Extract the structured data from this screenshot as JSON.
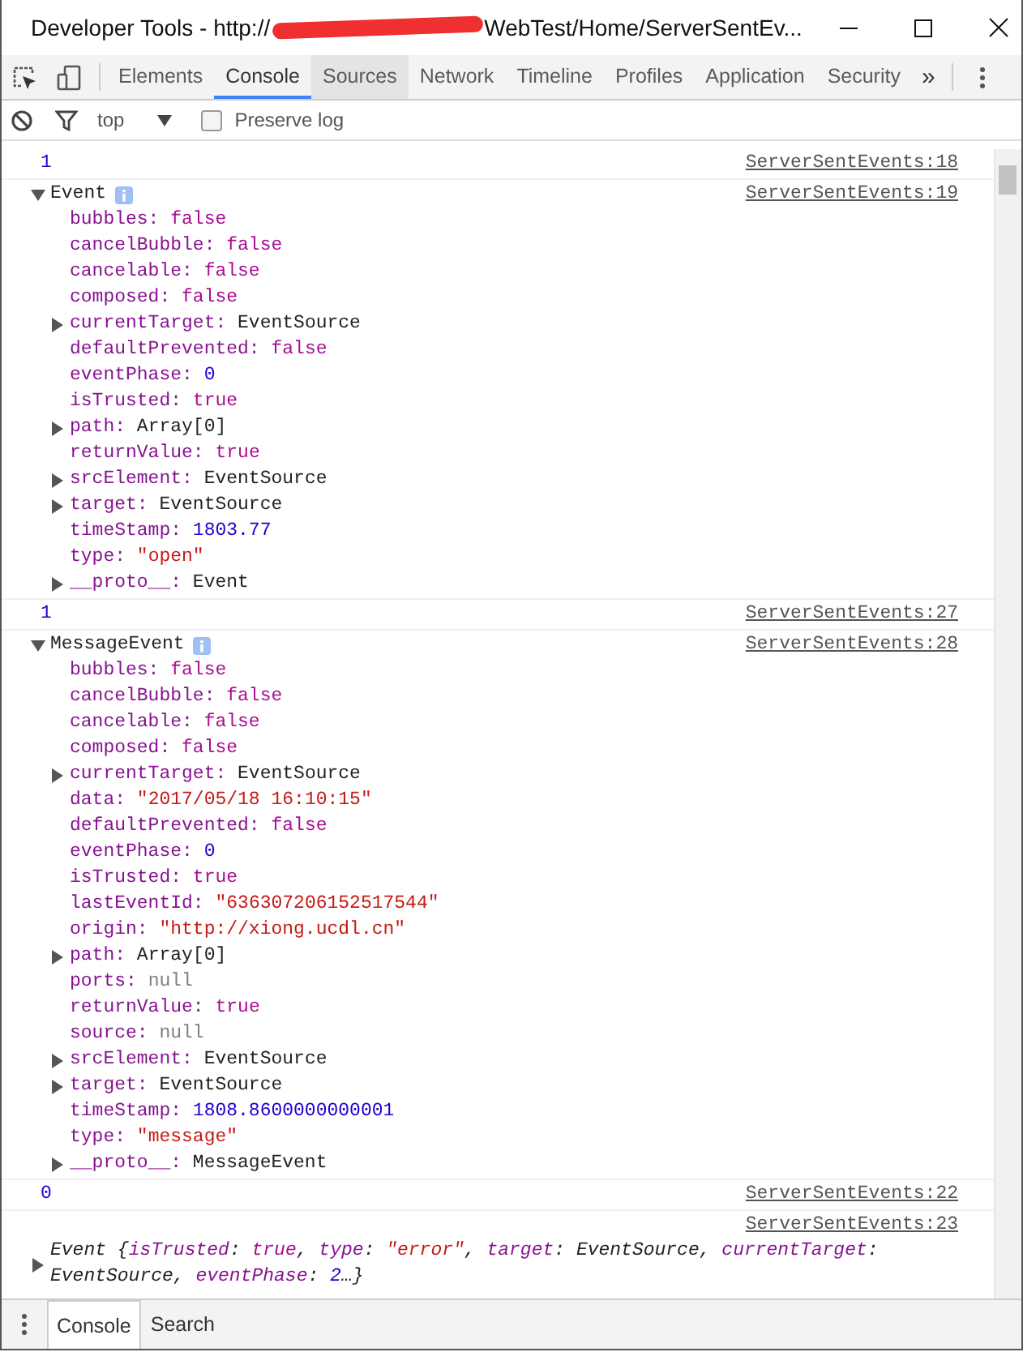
{
  "window": {
    "title_start": "Developer Tools - http://",
    "title_end": "WebTest/Home/ServerSentEv..."
  },
  "toolbar": {
    "tabs": [
      {
        "label": "Elements",
        "selected": false,
        "hovered": false
      },
      {
        "label": "Console",
        "selected": true,
        "hovered": false
      },
      {
        "label": "Sources",
        "selected": false,
        "hovered": true
      },
      {
        "label": "Network",
        "selected": false,
        "hovered": false
      },
      {
        "label": "Timeline",
        "selected": false,
        "hovered": false
      },
      {
        "label": "Profiles",
        "selected": false,
        "hovered": false
      },
      {
        "label": "Application",
        "selected": false,
        "hovered": false
      },
      {
        "label": "Security",
        "selected": false,
        "hovered": false
      }
    ],
    "overflow": "»"
  },
  "filter_bar": {
    "context": "top",
    "preserve_log": {
      "label": "Preserve log",
      "checked": false
    }
  },
  "console": {
    "entries": [
      {
        "kind": "value",
        "text": "1",
        "source": "ServerSentEvents:18"
      },
      {
        "kind": "object",
        "name": "Event",
        "expanded": true,
        "source": "ServerSentEvents:19",
        "properties": [
          {
            "key": "bubbles:",
            "value": "false",
            "kind": "boolean",
            "expandable": false
          },
          {
            "key": "cancelBubble:",
            "value": "false",
            "kind": "boolean",
            "expandable": false
          },
          {
            "key": "cancelable:",
            "value": "false",
            "kind": "boolean",
            "expandable": false
          },
          {
            "key": "composed:",
            "value": "false",
            "kind": "boolean",
            "expandable": false
          },
          {
            "key": "currentTarget:",
            "value": "EventSource",
            "kind": "object",
            "expandable": true
          },
          {
            "key": "defaultPrevented:",
            "value": "false",
            "kind": "boolean",
            "expandable": false
          },
          {
            "key": "eventPhase:",
            "value": "0",
            "kind": "number",
            "expandable": false
          },
          {
            "key": "isTrusted:",
            "value": "true",
            "kind": "boolean",
            "expandable": false
          },
          {
            "key": "path:",
            "value": "Array[0]",
            "kind": "object",
            "expandable": true
          },
          {
            "key": "returnValue:",
            "value": "true",
            "kind": "boolean",
            "expandable": false
          },
          {
            "key": "srcElement:",
            "value": "EventSource",
            "kind": "object",
            "expandable": true
          },
          {
            "key": "target:",
            "value": "EventSource",
            "kind": "object",
            "expandable": true
          },
          {
            "key": "timeStamp:",
            "value": "1803.77",
            "kind": "number",
            "expandable": false
          },
          {
            "key": "type:",
            "value": "\"open\"",
            "kind": "string",
            "expandable": false
          },
          {
            "key": "__proto__:",
            "value": "Event",
            "kind": "object",
            "expandable": true
          }
        ]
      },
      {
        "kind": "value",
        "text": "1",
        "source": "ServerSentEvents:27"
      },
      {
        "kind": "object",
        "name": "MessageEvent",
        "expanded": true,
        "source": "ServerSentEvents:28",
        "properties": [
          {
            "key": "bubbles:",
            "value": "false",
            "kind": "boolean",
            "expandable": false
          },
          {
            "key": "cancelBubble:",
            "value": "false",
            "kind": "boolean",
            "expandable": false
          },
          {
            "key": "cancelable:",
            "value": "false",
            "kind": "boolean",
            "expandable": false
          },
          {
            "key": "composed:",
            "value": "false",
            "kind": "boolean",
            "expandable": false
          },
          {
            "key": "currentTarget:",
            "value": "EventSource",
            "kind": "object",
            "expandable": true
          },
          {
            "key": "data:",
            "value": "\"2017/05/18 16:10:15\"",
            "kind": "string",
            "expandable": false
          },
          {
            "key": "defaultPrevented:",
            "value": "false",
            "kind": "boolean",
            "expandable": false
          },
          {
            "key": "eventPhase:",
            "value": "0",
            "kind": "number",
            "expandable": false
          },
          {
            "key": "isTrusted:",
            "value": "true",
            "kind": "boolean",
            "expandable": false
          },
          {
            "key": "lastEventId:",
            "value": "\"636307206152517544\"",
            "kind": "string",
            "expandable": false
          },
          {
            "key": "origin:",
            "value": "\"http://xiong.ucdl.cn\"",
            "kind": "string",
            "expandable": false
          },
          {
            "key": "path:",
            "value": "Array[0]",
            "kind": "object",
            "expandable": true
          },
          {
            "key": "ports:",
            "value": "null",
            "kind": "null",
            "expandable": false
          },
          {
            "key": "returnValue:",
            "value": "true",
            "kind": "boolean",
            "expandable": false
          },
          {
            "key": "source:",
            "value": "null",
            "kind": "null",
            "expandable": false
          },
          {
            "key": "srcElement:",
            "value": "EventSource",
            "kind": "object",
            "expandable": true
          },
          {
            "key": "target:",
            "value": "EventSource",
            "kind": "object",
            "expandable": true
          },
          {
            "key": "timeStamp:",
            "value": "1808.8600000000001",
            "kind": "number",
            "expandable": false
          },
          {
            "key": "type:",
            "value": "\"message\"",
            "kind": "string",
            "expandable": false
          },
          {
            "key": "__proto__:",
            "value": "MessageEvent",
            "kind": "object",
            "expandable": true
          }
        ]
      },
      {
        "kind": "value",
        "text": "0",
        "source": "ServerSentEvents:22"
      },
      {
        "kind": "preview",
        "expanded": false,
        "source": "ServerSentEvents:23",
        "segments": [
          {
            "text": "Event {",
            "kind": "plain"
          },
          {
            "text": "isTrusted",
            "kind": "key"
          },
          {
            "text": ": ",
            "kind": "plain"
          },
          {
            "text": "true",
            "kind": "boolean"
          },
          {
            "text": ", ",
            "kind": "plain"
          },
          {
            "text": "type",
            "kind": "key"
          },
          {
            "text": ": ",
            "kind": "plain"
          },
          {
            "text": "\"error\"",
            "kind": "string"
          },
          {
            "text": ", ",
            "kind": "plain"
          },
          {
            "text": "target",
            "kind": "key"
          },
          {
            "text": ": EventSource, ",
            "kind": "plain"
          },
          {
            "text": "currentTarget",
            "kind": "key"
          },
          {
            "text": ": EventSource, ",
            "kind": "plain"
          },
          {
            "text": "eventPhase",
            "kind": "key"
          },
          {
            "text": ": ",
            "kind": "plain"
          },
          {
            "text": "2",
            "kind": "number"
          },
          {
            "text": "…}",
            "kind": "plain"
          }
        ]
      }
    ]
  },
  "drawer": {
    "tabs": [
      {
        "label": "Console",
        "selected": true
      },
      {
        "label": "Search",
        "selected": false
      }
    ]
  }
}
